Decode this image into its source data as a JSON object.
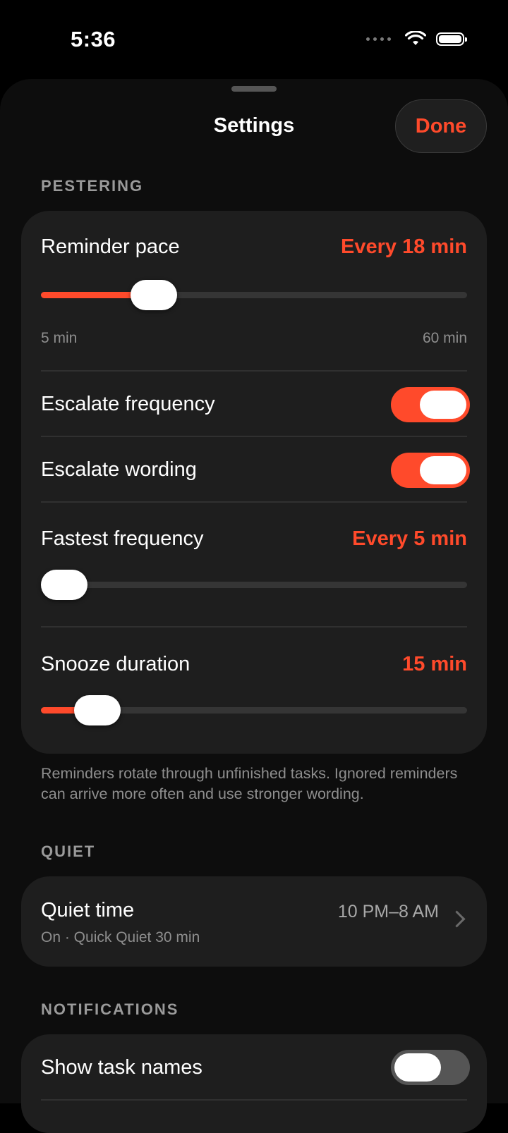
{
  "status_bar": {
    "time": "5:36"
  },
  "sheet": {
    "title": "Settings",
    "done_label": "Done"
  },
  "pestering": {
    "header": "PESTERING",
    "reminder_pace": {
      "label": "Reminder pace",
      "value": "Every 18 min",
      "min_label": "5 min",
      "max_label": "60 min",
      "fraction": 0.236
    },
    "escalate_frequency": {
      "label": "Escalate frequency",
      "on": true
    },
    "escalate_wording": {
      "label": "Escalate wording",
      "on": true
    },
    "fastest_frequency": {
      "label": "Fastest frequency",
      "value": "Every 5 min",
      "fraction": 0.0
    },
    "snooze_duration": {
      "label": "Snooze duration",
      "value": "15 min",
      "fraction": 0.08
    },
    "footnote": "Reminders rotate through unfinished tasks. Ignored reminders can arrive more often and use stronger wording."
  },
  "quiet": {
    "header": "QUIET",
    "quiet_time": {
      "label": "Quiet time",
      "subtitle": "On · Quick Quiet 30 min",
      "value": "10 PM–8 AM"
    }
  },
  "notifications": {
    "header": "NOTIFICATIONS",
    "show_task_names": {
      "label": "Show task names",
      "on": false
    }
  },
  "colors": {
    "accent": "#ff4a2b",
    "card": "#1e1e1e",
    "background": "#000000"
  }
}
